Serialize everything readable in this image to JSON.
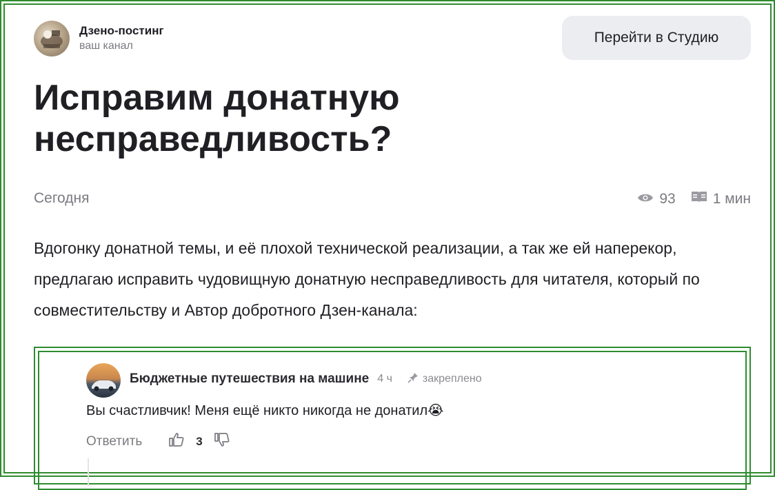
{
  "channel": {
    "name": "Дзено-постинг",
    "subtitle": "ваш канал"
  },
  "header": {
    "studio_button": "Перейти в Студию"
  },
  "article": {
    "title": "Исправим донатную несправедливость?",
    "date": "Сегодня",
    "views": "93",
    "read_time": "1 мин",
    "body": "Вдогонку донатной темы, и её плохой технической реализации, а так же ей наперекор, предлагаю исправить чудовищную донатную несправедливость для читателя, который по совместительству и Автор добротного Дзен-канала:"
  },
  "comment": {
    "author": "Бюджетные путешествия на машине",
    "time": "4 ч",
    "pinned": "закреплено",
    "text": "Вы счастливчик! Меня ещё никто никогда не донатил",
    "emoji": "😭",
    "reply_label": "Ответить",
    "likes": "3"
  },
  "colors": {
    "frame": "#2e8b2e",
    "button_bg": "#ebedf0",
    "muted": "#7a7a80"
  }
}
